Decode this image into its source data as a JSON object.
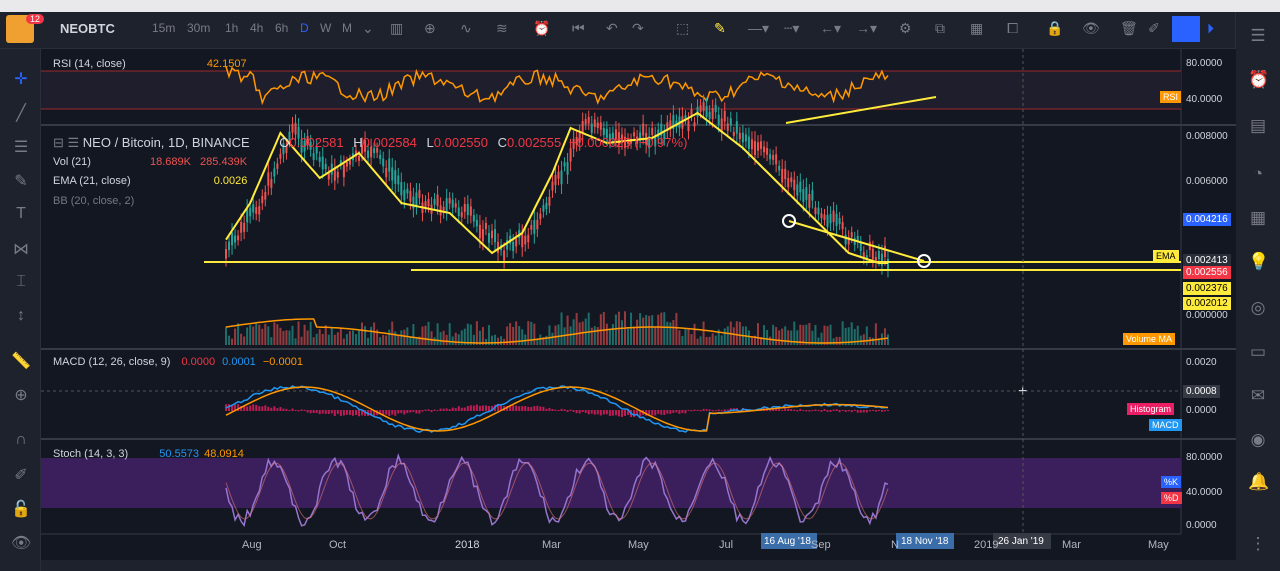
{
  "toolbar": {
    "notifications": "12",
    "symbol": "NEOBTC",
    "intervals": [
      "15m",
      "30m",
      "1h",
      "4h",
      "6h",
      "D",
      "W",
      "M"
    ],
    "active_interval": "D"
  },
  "rsi": {
    "label": "RSI (14, close)",
    "value": "42.1507",
    "scale": [
      "80.0000",
      "40.0000"
    ],
    "tag": "RSI"
  },
  "main": {
    "title": "NEO / Bitcoin, 1D, BINANCE",
    "o_label": "O",
    "o_value": "0.002581",
    "h_label": "H",
    "h_value": "0.002584",
    "l_label": "L",
    "l_value": "0.002550",
    "c_label": "C",
    "c_value": "0.002555",
    "change": "−0.000025 (−0.97%)",
    "vol_label": "Vol (21)",
    "vol_value1": "18.689K",
    "vol_value2": "285.439K",
    "ema_label": "EMA (21, close)",
    "ema_value": "0.0026",
    "bb_label": "BB (20, close, 2)",
    "scale": [
      "0.008000",
      "0.006000",
      "0.000000"
    ],
    "price_tags": [
      {
        "label": "0.004216",
        "color": "#2962ff"
      },
      {
        "label": "0.002413",
        "color": "#2a2e39"
      },
      {
        "label": "0.002556",
        "color": "#f23645"
      },
      {
        "label": "0.002376",
        "color": "#ffeb3b"
      },
      {
        "label": "0.002012",
        "color": "#ffeb3b"
      }
    ],
    "ema_tag": "EMA",
    "volume_tag": "Volume MA"
  },
  "macd": {
    "label": "MACD (12, 26, close, 9)",
    "v1": "0.0000",
    "v2": "0.0001",
    "v3": "−0.0001",
    "scale": [
      "0.0020",
      "0.0000"
    ],
    "cursor_value": "0.0008",
    "tags": [
      "Histogram",
      "MACD"
    ]
  },
  "stoch": {
    "label": "Stoch (14, 3, 3)",
    "v1": "50.5573",
    "v2": "48.0914",
    "scale": [
      "80.0000",
      "40.0000",
      "0.0000"
    ],
    "tags": [
      "%K",
      "%D"
    ]
  },
  "time_axis": {
    "labels": [
      "Aug",
      "Oct",
      "2018",
      "Mar",
      "May",
      "Jul",
      "Sep",
      "N",
      "2019",
      "Mar",
      "May"
    ],
    "highlight_1": "16 Aug '18",
    "highlight_2": "18 Nov '18",
    "cursor_date": "26 Jan '19"
  },
  "colors": {
    "bg": "#131722",
    "rsi": "#ff9800",
    "ema": "#ffeb3b",
    "macd": "#2196f3",
    "signal": "#ff9800",
    "stoch": "#9575cd"
  }
}
